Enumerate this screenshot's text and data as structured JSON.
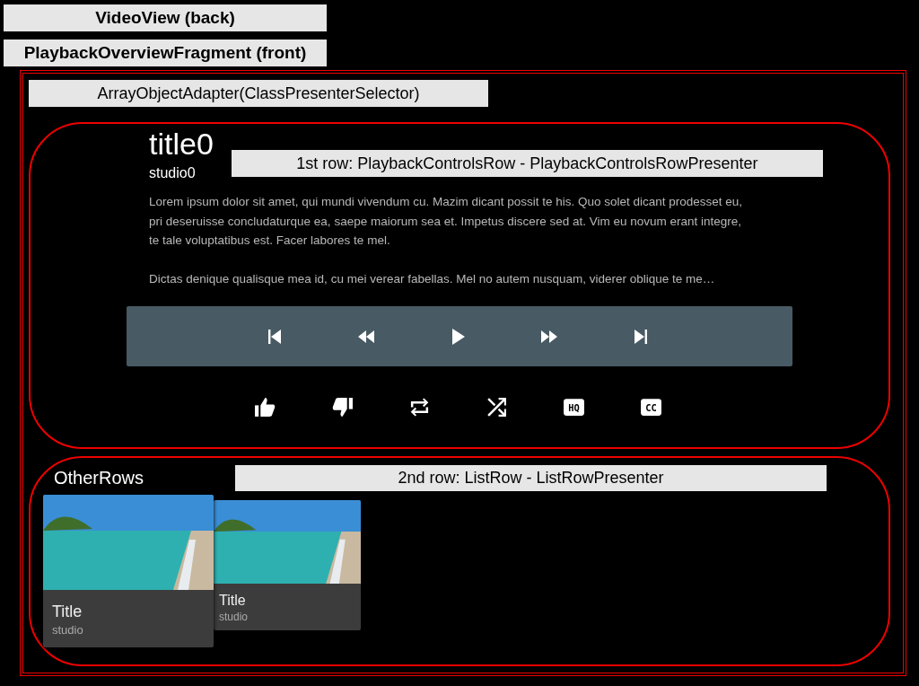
{
  "labels": {
    "back": "VideoView (back)",
    "front": "PlaybackOverviewFragment (front)",
    "adapter": "ArrayObjectAdapter(ClassPresenterSelector)"
  },
  "rows": [
    {
      "kind": "playback",
      "annotation": "1st row: PlaybackControlsRow - PlaybackControlsRowPresenter",
      "title": "title0",
      "studio": "studio0",
      "description": [
        "Lorem ipsum dolor sit amet, qui mundi vivendum cu. Mazim dicant possit te his. Quo solet dicant prodesset eu, pri deseruisse concludaturque ea, saepe maiorum sea et. Impetus discere sed at. Vim eu novum erant integre, te tale voluptatibus est. Facer labores te mel.",
        "Dictas denique qualisque mea id, cu mei verear fabellas. Mel no autem nusquam, viderer oblique te me…"
      ],
      "primary_actions": [
        {
          "kind": "skip-previous"
        },
        {
          "kind": "rewind"
        },
        {
          "kind": "play"
        },
        {
          "kind": "fast-forward"
        },
        {
          "kind": "skip-next"
        }
      ],
      "secondary_actions": [
        {
          "kind": "thumbs-up"
        },
        {
          "kind": "thumbs-down"
        },
        {
          "kind": "repeat"
        },
        {
          "kind": "shuffle"
        },
        {
          "kind": "badge",
          "label": "HQ"
        },
        {
          "kind": "badge",
          "label": "CC"
        }
      ]
    },
    {
      "kind": "list",
      "annotation": "2nd row: ListRow - ListRowPresenter",
      "header": "OtherRows",
      "cards": [
        {
          "title": "Title",
          "studio": "studio",
          "selected": true
        },
        {
          "title": "Title",
          "studio": "studio",
          "selected": false
        }
      ]
    }
  ]
}
